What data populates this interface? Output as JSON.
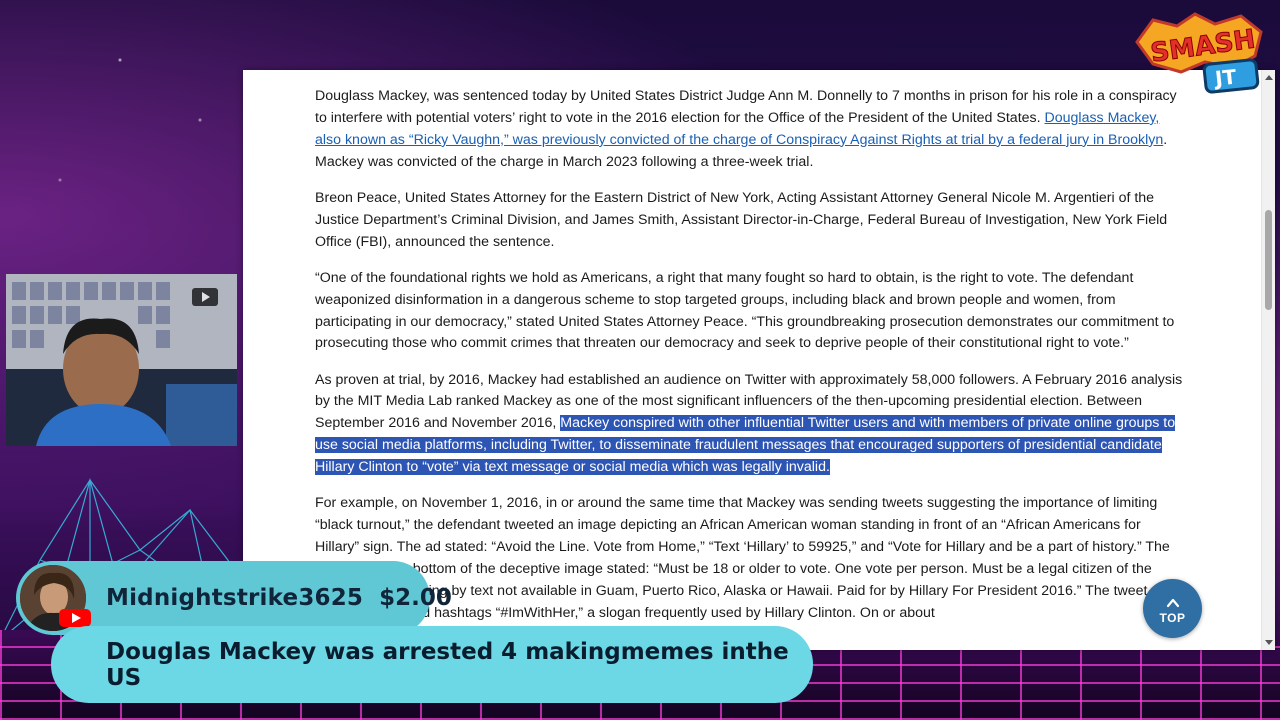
{
  "article": {
    "p1_text": "Douglass Mackey, was sentenced today by United States District Judge Ann M. Donnelly to 7 months in prison for his role in a conspiracy to interfere with potential voters’ right to vote in the 2016 election for the Office of the President of the United States. ",
    "p1_link": "Douglass Mackey, also known as “Ricky Vaughn,” was previously convicted of the charge of Conspiracy Against Rights at trial by a federal jury in Brooklyn",
    "p1_tail": ". Mackey was convicted of the charge in March 2023 following a three-week trial.",
    "p2": "Breon Peace, United States Attorney for the Eastern District of New York, Acting Assistant Attorney General Nicole M. Argentieri of the Justice Department’s Criminal Division, and James Smith, Assistant Director-in-Charge, Federal Bureau of Investigation, New York Field Office (FBI), announced the sentence.",
    "p3": "“One of the foundational rights we hold as Americans, a right that many fought so hard to obtain, is the right to vote.  The defendant weaponized disinformation in a dangerous scheme to stop targeted groups, including black and brown people and women, from participating in our democracy,” stated United States Attorney Peace. “This groundbreaking prosecution demonstrates our commitment to prosecuting those who commit crimes that threaten our democracy and seek to deprive people of their constitutional right to vote.”",
    "p4_text": "As proven at trial, by 2016, Mackey had established an audience on Twitter with approximately 58,000 followers. A February 2016 analysis by the MIT Media Lab ranked Mackey as one of the most significant influencers of the then-upcoming presidential election.  Between September 2016 and November 2016, ",
    "p4_highlight": "Mackey conspired with other influential Twitter users and with members of private online groups to use social media platforms, including Twitter, to disseminate fraudulent messages that encouraged supporters of presidential candidate Hillary Clinton to “vote” via text message or social media which was legally invalid.",
    "p5": "For example, on November 1, 2016, in or around the same time that Mackey was sending tweets suggesting the importance of limiting “black turnout,” the defendant tweeted an image depicting an African American woman standing in front of an “African Americans for Hillary” sign. The ad stated: “Avoid the Line. Vote from Home,” “Text ‘Hillary’ to 59925,” and “Vote for Hillary and be a part of history.” The fine print at the bottom of the deceptive image stated: “Must be 18 or older to vote. One vote per person. Must be a legal citizen of the United States. Voting by text not available in Guam, Puerto Rico, Alaska or Hawaii. Paid for by Hillary For President 2016.” The tweet included the typed hashtags “#ImWithHer,” a slogan frequently used by Hillary Clinton.  On or about"
  },
  "top_button_label": "TOP",
  "logo": {
    "line1": "SMASH",
    "line2": "JT"
  },
  "donation": {
    "name": "Midnightstrike3625",
    "amount": "$2.00",
    "message": "Douglas Mackey was arrested 4 makingmemes inthe US"
  },
  "colors": {
    "link": "#1a5fb4",
    "highlight": "#2d55b4",
    "donation_bg": "#5fc8d4",
    "message_bg": "#6cd8e6",
    "top_button": "#2f6fa3"
  },
  "icons": [
    "chevron-up-icon",
    "youtube-icon",
    "scroll-up-icon",
    "scroll-down-icon"
  ]
}
